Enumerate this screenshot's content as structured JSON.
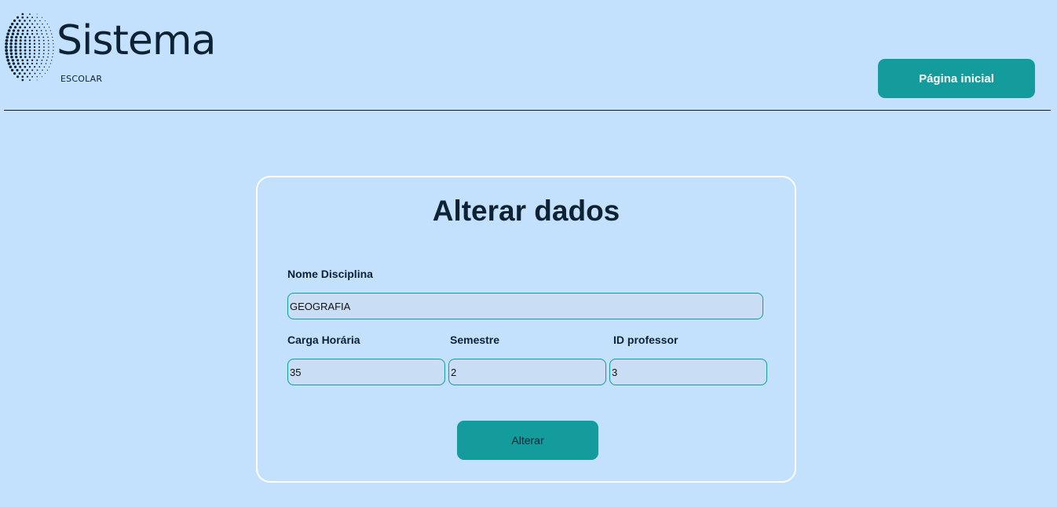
{
  "header": {
    "logo": {
      "title": "Sistema",
      "subtitle": "ESCOLAR",
      "icon": "dotted-globe-icon"
    },
    "home_button_label": "Página inicial"
  },
  "form": {
    "title": "Alterar dados",
    "fields": {
      "nome_disciplina": {
        "label": "Nome Disciplina",
        "value": "GEOGRAFIA"
      },
      "carga_horaria": {
        "label": "Carga Horária",
        "value": "35"
      },
      "semestre": {
        "label": "Semestre",
        "value": "2"
      },
      "id_professor": {
        "label": "ID professor",
        "value": "3"
      }
    },
    "submit_label": "Alterar"
  },
  "colors": {
    "background": "#c3e0fd",
    "accent": "#149b9b",
    "text": "#0d2233"
  }
}
